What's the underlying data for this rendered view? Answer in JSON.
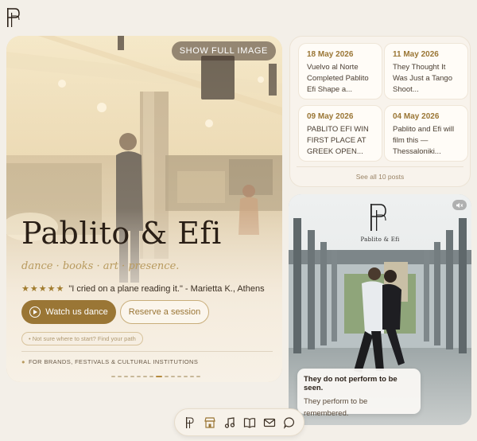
{
  "hero": {
    "show_full_label": "SHOW FULL IMAGE",
    "title": "Pablito & Efi",
    "tagline": "dance · books · art · presence.",
    "stars": "★★★★★",
    "review": "\"I cried on a plane reading it.\" - Marietta K., Athens",
    "watch_label": "Watch us dance",
    "reserve_label": "Reserve a session",
    "pathfinder_label": "• Not sure where to start? Find your path",
    "brands_label": "FOR BRANDS, FESTIVALS & CULTURAL INSTITUTIONS",
    "slides_total": 14,
    "slide_active": 7
  },
  "posts": {
    "items": [
      {
        "date": "18 May 2026",
        "text": "Vuelvo al Norte Completed Pablito Efi Shape a..."
      },
      {
        "date": "11 May 2026",
        "text": "They Thought It Was Just a Tango Shoot..."
      },
      {
        "date": "09 May 2026",
        "text": "PABLITO EFI WIN FIRST PLACE AT GREEK OPEN..."
      },
      {
        "date": "04 May 2026",
        "text": "Pablito and Efi will film this — Thessaloniki..."
      }
    ],
    "see_all_label": "See all 10 posts"
  },
  "video": {
    "brand": "Pablito & Efi",
    "caption_bold": "They do not perform to be seen.",
    "caption_text": "They perform to be remembered."
  },
  "nav": {
    "icons": [
      "logo-icon",
      "shop-icon",
      "music-icon",
      "book-icon",
      "mail-icon",
      "chat-icon"
    ]
  },
  "colors": {
    "accent": "#9a7635",
    "background": "#f3efe8"
  }
}
